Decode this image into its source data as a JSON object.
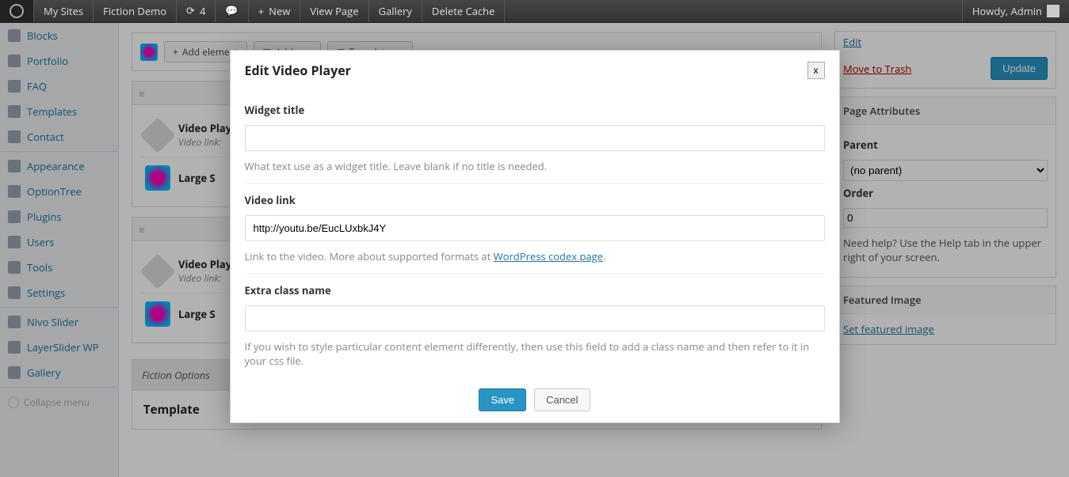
{
  "adminbar": {
    "my_sites": "My Sites",
    "site_name": "Fiction Demo",
    "updates_count": "4",
    "new": "New",
    "view_page": "View Page",
    "gallery": "Gallery",
    "delete_cache": "Delete Cache",
    "howdy": "Howdy, Admin"
  },
  "sidebar": {
    "items": [
      {
        "label": "Blocks"
      },
      {
        "label": "Portfolio"
      },
      {
        "label": "FAQ"
      },
      {
        "label": "Templates"
      },
      {
        "label": "Contact"
      },
      {
        "label": "Appearance"
      },
      {
        "label": "OptionTree"
      },
      {
        "label": "Plugins"
      },
      {
        "label": "Users"
      },
      {
        "label": "Tools"
      },
      {
        "label": "Settings"
      },
      {
        "label": "Nivo Slider"
      },
      {
        "label": "LayerSlider WP"
      },
      {
        "label": "Gallery"
      }
    ],
    "collapse": "Collapse menu"
  },
  "builder": {
    "add_element": "Add element",
    "add_row": "Add row",
    "templates": "Templates",
    "rows": [
      {
        "items": [
          {
            "title": "Video Player",
            "sub": "Video link:"
          },
          {
            "title": "Large S",
            "sub": ""
          }
        ]
      },
      {
        "items": [
          {
            "title": "Video Player",
            "sub": "Video link:"
          },
          {
            "title": "Large S",
            "sub": ""
          }
        ]
      }
    ]
  },
  "publish": {
    "edit": "Edit",
    "trash": "Move to Trash",
    "update": "Update"
  },
  "page_attr": {
    "heading": "Page Attributes",
    "parent_label": "Parent",
    "parent_value": "(no parent)",
    "order_label": "Order",
    "order_value": "0",
    "help": "Need help? Use the Help tab in the upper right of your screen."
  },
  "featured": {
    "heading": "Featured Image",
    "link": "Set featured image"
  },
  "fiction": {
    "heading": "Fiction Options",
    "template": "Template"
  },
  "modal": {
    "title": "Edit Video Player",
    "close": "x",
    "widget_title_label": "Widget title",
    "widget_title_value": "",
    "widget_title_hint": "What text use as a widget title. Leave blank if no title is needed.",
    "video_link_label": "Video link",
    "video_link_value": "http://youtu.be/EucLUxbkJ4Y",
    "video_link_hint_pre": "Link to the video. More about supported formats at ",
    "video_link_hint_link": "WordPress codex page",
    "video_link_hint_post": ".",
    "extra_class_label": "Extra class name",
    "extra_class_value": "",
    "extra_class_hint": "If you wish to style particular content element differently, then use this field to add a class name and then refer to it in your css file.",
    "save": "Save",
    "cancel": "Cancel"
  }
}
